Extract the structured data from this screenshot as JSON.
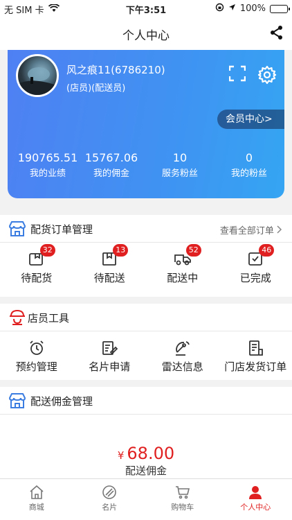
{
  "status_bar": {
    "carrier": "无 SIM 卡",
    "time": "下午3:51",
    "battery": "100%"
  },
  "nav": {
    "title": "个人中心"
  },
  "profile": {
    "name": "风之痕11(6786210)",
    "role": "(店员)(配送员)",
    "member_center_label": "会员中心>",
    "stats": [
      {
        "value": "190765.51",
        "label": "我的业绩"
      },
      {
        "value": "15767.06",
        "label": "我的佣金"
      },
      {
        "value": "10",
        "label": "服务粉丝"
      },
      {
        "value": "0",
        "label": "我的粉丝"
      }
    ]
  },
  "orders": {
    "title": "配货订单管理",
    "view_all": "查看全部订单",
    "items": [
      {
        "label": "待配货",
        "badge": "32",
        "icon": "pending-box-icon"
      },
      {
        "label": "待配送",
        "badge": "13",
        "icon": "package-icon"
      },
      {
        "label": "配送中",
        "badge": "52",
        "icon": "truck-icon"
      },
      {
        "label": "已完成",
        "badge": "46",
        "icon": "check-clipboard-icon"
      }
    ]
  },
  "tools": {
    "title": "店员工具",
    "items": [
      {
        "label": "预约管理",
        "icon": "alarm-clock-icon"
      },
      {
        "label": "名片申请",
        "icon": "edit-document-icon"
      },
      {
        "label": "雷达信息",
        "icon": "radar-icon"
      },
      {
        "label": "门店发货订单",
        "icon": "receipt-icon"
      }
    ]
  },
  "commission": {
    "title": "配送佣金管理",
    "currency": "¥",
    "amount": "68.00",
    "label": "配送佣金"
  },
  "tabbar": [
    {
      "label": "商城",
      "icon": "home-icon",
      "active": false
    },
    {
      "label": "名片",
      "icon": "card-icon",
      "active": false
    },
    {
      "label": "购物车",
      "icon": "cart-icon",
      "active": false
    },
    {
      "label": "个人中心",
      "icon": "person-icon",
      "active": true
    }
  ],
  "colors": {
    "accent": "#e02020",
    "card_start": "#4f80f3",
    "card_end": "#35a5f2",
    "icon_blue": "#3b7de0"
  }
}
